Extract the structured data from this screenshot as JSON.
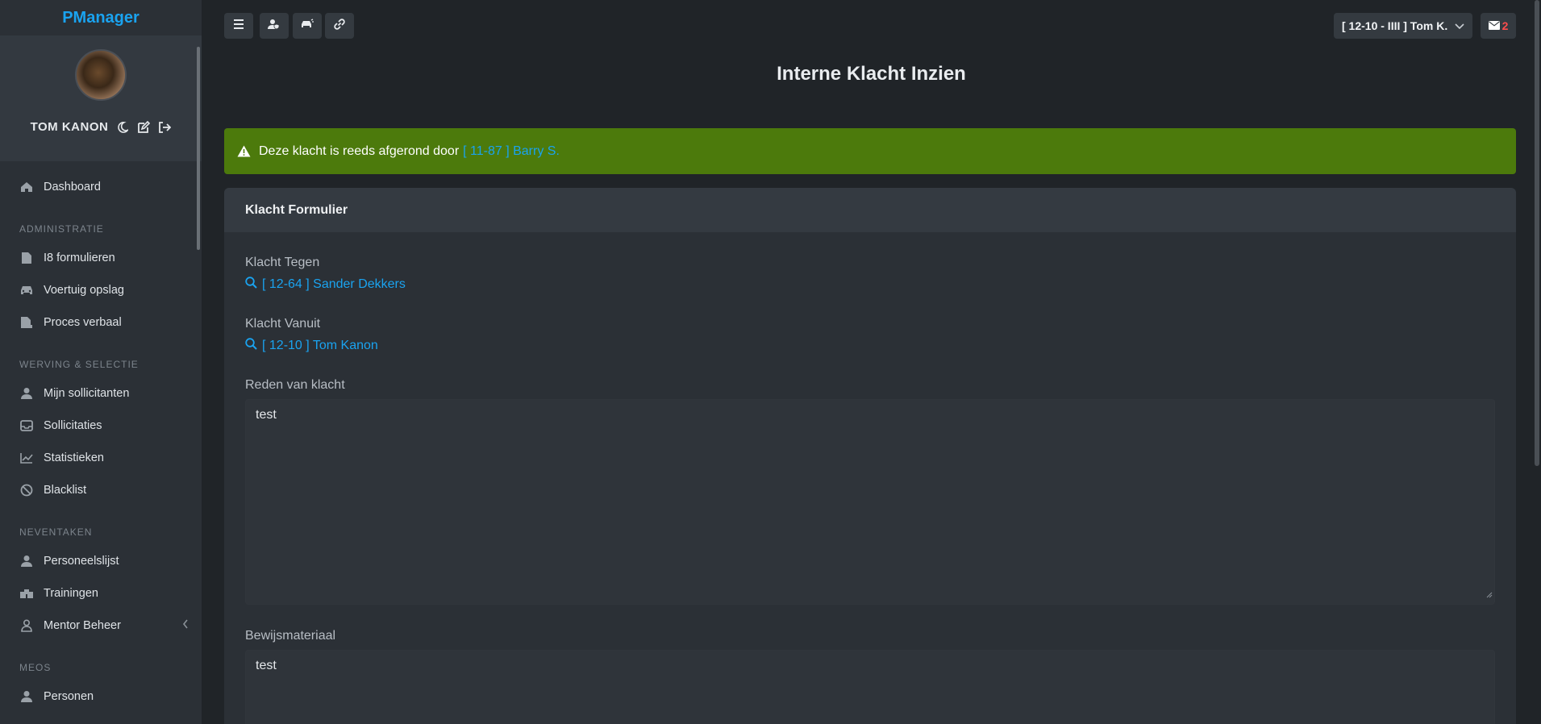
{
  "brand": "PManager",
  "profile": {
    "name": "TOM KANON",
    "icons": [
      "moon-icon",
      "edit-icon",
      "logout-icon"
    ]
  },
  "sidebar": {
    "dashboard": "Dashboard",
    "sections": [
      {
        "title": "ADMINISTRATIE",
        "items": [
          "I8 formulieren",
          "Voertuig opslag",
          "Proces verbaal"
        ]
      },
      {
        "title": "WERVING & SELECTIE",
        "items": [
          "Mijn sollicitanten",
          "Sollicitaties",
          "Statistieken",
          "Blacklist"
        ]
      },
      {
        "title": "NEVENTAKEN",
        "items": [
          "Personeelslijst",
          "Trainingen",
          "Mentor Beheer"
        ]
      },
      {
        "title": "MEOS",
        "items": [
          "Personen"
        ]
      }
    ]
  },
  "topbar": {
    "user_label": "[ 12-10 - IIII ] Tom K.",
    "mail_count": "2"
  },
  "page": {
    "title": "Interne Klacht Inzien",
    "alert_text": "Deze klacht is reeds afgerond door",
    "alert_link": "[ 11-87 ] Barry S."
  },
  "form": {
    "header": "Klacht Formulier",
    "against_label": "Klacht Tegen",
    "against_value": "[ 12-64 ] Sander Dekkers",
    "from_label": "Klacht Vanuit",
    "from_value": "[ 12-10 ] Tom Kanon",
    "reason_label": "Reden van klacht",
    "reason_value": "test",
    "evidence_label": "Bewijsmateriaal",
    "evidence_value": "test"
  },
  "colors": {
    "accent": "#1aa3f0",
    "alert_bg": "#4c7a0c",
    "badge": "#ff4d4d"
  }
}
